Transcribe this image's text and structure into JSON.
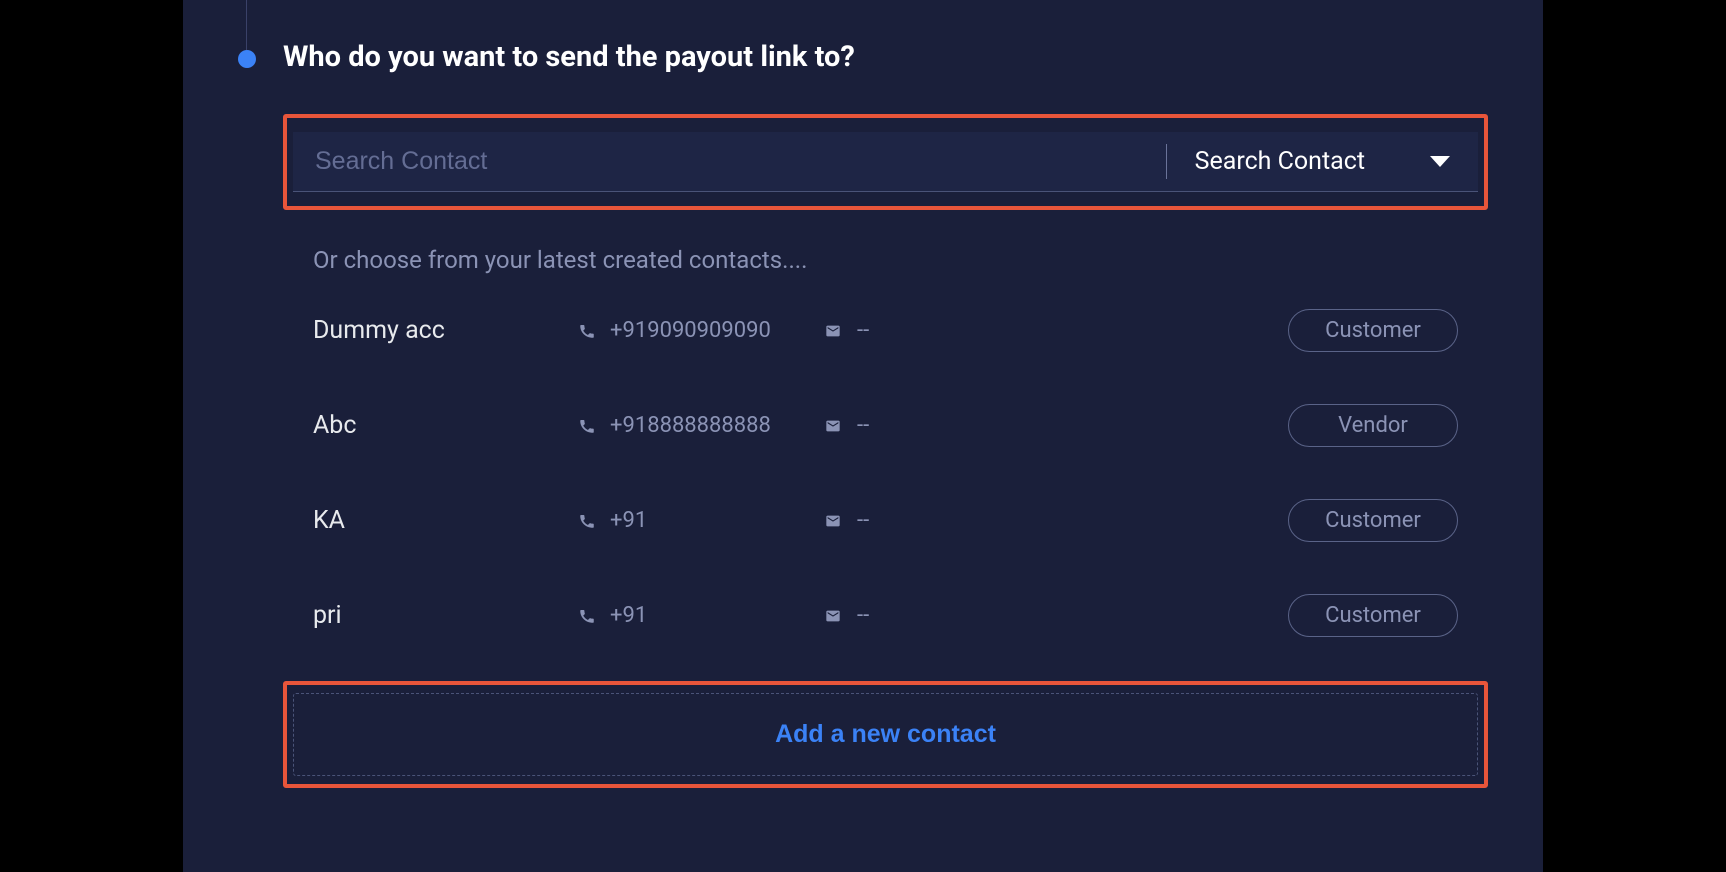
{
  "step": {
    "heading": "Who do you want to send the payout link to?"
  },
  "search": {
    "placeholder": "Search Contact",
    "dropdown_label": "Search Contact"
  },
  "subheader": "Or choose from your latest created contacts....",
  "contacts": [
    {
      "name": "Dummy acc",
      "phone": "+919090909090",
      "email": "--",
      "type": "Customer"
    },
    {
      "name": "Abc",
      "phone": "+918888888888",
      "email": "--",
      "type": "Vendor"
    },
    {
      "name": "KA",
      "phone": "+91",
      "email": "--",
      "type": "Customer"
    },
    {
      "name": "pri",
      "phone": "+91",
      "email": "--",
      "type": "Customer"
    }
  ],
  "add_contact_label": "Add a new contact"
}
